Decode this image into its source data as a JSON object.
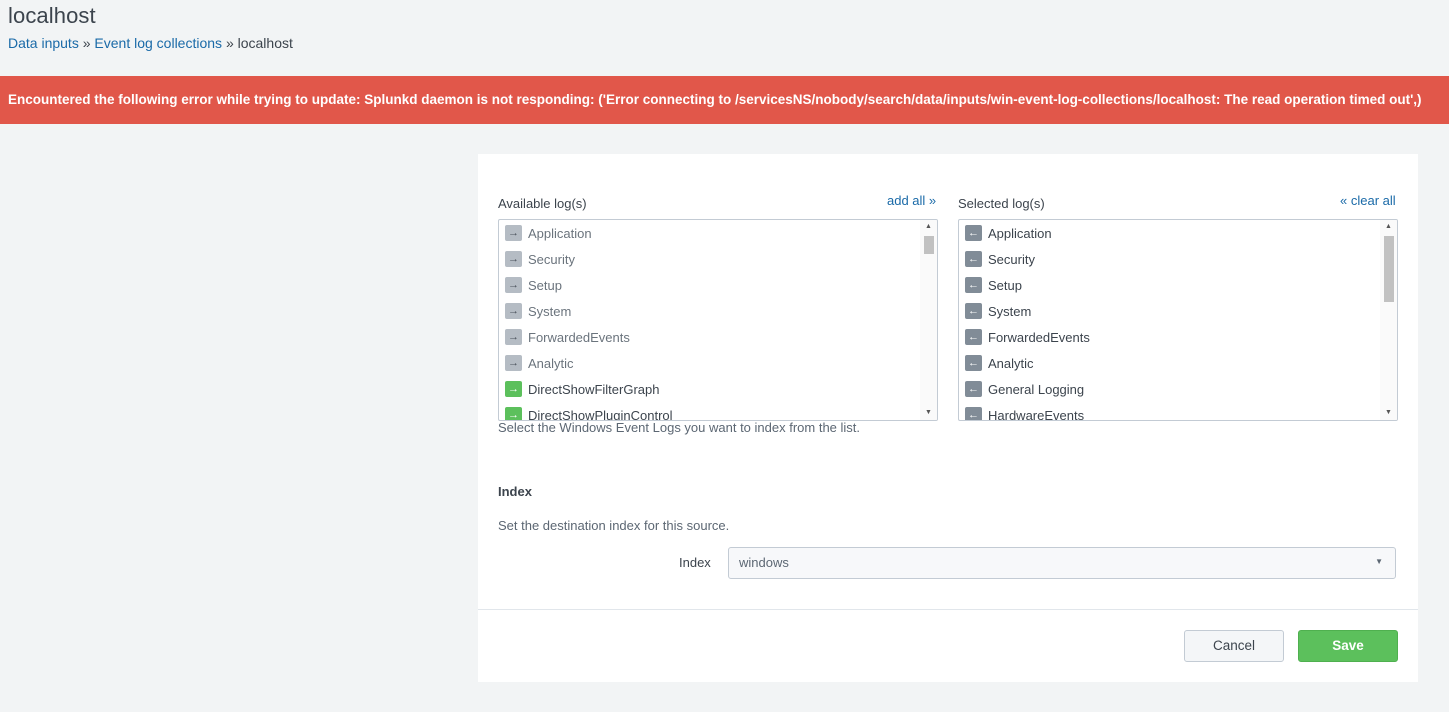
{
  "header": {
    "title": "localhost",
    "breadcrumb": {
      "link1": "Data inputs",
      "sep1": "»",
      "link2": "Event log collections",
      "sep2": "»",
      "current": "localhost"
    }
  },
  "error": {
    "message": "Encountered the following error while trying to update: Splunkd daemon is not responding: ('Error connecting to /servicesNS/nobody/search/data/inputs/win-event-log-collections/localhost: The read operation timed out',)"
  },
  "available": {
    "label": "Available log(s)",
    "action": "add all »",
    "items": [
      {
        "label": "Application"
      },
      {
        "label": "Security"
      },
      {
        "label": "Setup"
      },
      {
        "label": "System"
      },
      {
        "label": "ForwardedEvents"
      },
      {
        "label": "Analytic"
      },
      {
        "label": "DirectShowFilterGraph"
      },
      {
        "label": "DirectShowPluginControl"
      }
    ]
  },
  "selected": {
    "label": "Selected log(s)",
    "action": "« clear all",
    "items": [
      {
        "label": "Application"
      },
      {
        "label": "Security"
      },
      {
        "label": "Setup"
      },
      {
        "label": "System"
      },
      {
        "label": "ForwardedEvents"
      },
      {
        "label": "Analytic"
      },
      {
        "label": "General Logging"
      },
      {
        "label": "HardwareEvents"
      }
    ]
  },
  "help": "Select the Windows Event Logs you want to index from the list.",
  "index_section": {
    "title": "Index",
    "help": "Set the destination index for this source.",
    "field_label": "Index",
    "value": "windows"
  },
  "buttons": {
    "cancel": "Cancel",
    "save": "Save"
  },
  "colors": {
    "error": "#e1574a",
    "link": "#1a6aa8",
    "save": "#5cc05c"
  }
}
